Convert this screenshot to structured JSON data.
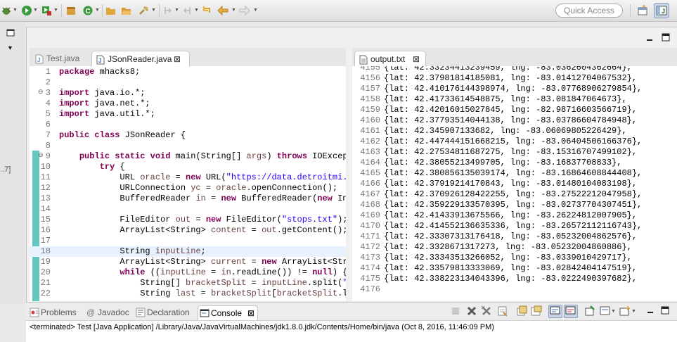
{
  "toolbar": {
    "quick_access_placeholder": "Quick Access"
  },
  "left_strip": {
    "marker": "..7]"
  },
  "editor_tabs": [
    {
      "label": "Test.java"
    },
    {
      "label": "JSonReader.java"
    }
  ],
  "output_tab": {
    "label": "output.txt"
  },
  "code_lines": [
    {
      "n": "1",
      "text": "package mhacks8;"
    },
    {
      "n": "2",
      "text": ""
    },
    {
      "n": "3",
      "text": "import java.io.*;"
    },
    {
      "n": "4",
      "text": "import java.net.*;"
    },
    {
      "n": "5",
      "text": "import java.util.*;"
    },
    {
      "n": "6",
      "text": ""
    },
    {
      "n": "7",
      "text": "public class JSonReader {"
    },
    {
      "n": "8",
      "text": ""
    },
    {
      "n": "9",
      "text": "    public static void main(String[] args) throws IOExcep"
    },
    {
      "n": "10",
      "text": "        try {"
    },
    {
      "n": "11",
      "text": "            URL oracle = new URL(\"https://data.detroitmi."
    },
    {
      "n": "12",
      "text": "            URLConnection yc = oracle.openConnection();"
    },
    {
      "n": "13",
      "text": "            BufferedReader in = new BufferedReader(new In"
    },
    {
      "n": "14",
      "text": ""
    },
    {
      "n": "15",
      "text": "            FileEditor out = new FileEditor(\"stops.txt\");"
    },
    {
      "n": "16",
      "text": "            ArrayList<String> content = out.getContent();"
    },
    {
      "n": "17",
      "text": ""
    },
    {
      "n": "18",
      "text": "            String inputLine;"
    },
    {
      "n": "19",
      "text": "            ArrayList<String> current = new ArrayList<Str"
    },
    {
      "n": "20",
      "text": "            while ((inputLine = in.readLine()) != null) {"
    },
    {
      "n": "21",
      "text": "                String[] bracketSplit = inputLine.split(\""
    },
    {
      "n": "22",
      "text": "                String last = bracketSplit[bracketSplit.l"
    }
  ],
  "output_lines": [
    {
      "n": "4155",
      "text": "{lat: 42.33234413239459, lng: -83.0362604362664},"
    },
    {
      "n": "4156",
      "text": "{lat: 42.37981814185081, lng: -83.01412704067532},"
    },
    {
      "n": "4157",
      "text": "{lat: 42.410176144398974, lng: -83.07768906279854},"
    },
    {
      "n": "4158",
      "text": "{lat: 42.41733614548875, lng: -83.081847064673},"
    },
    {
      "n": "4159",
      "text": "{lat: 42.42016015027845, lng: -82.98716603566719},"
    },
    {
      "n": "4160",
      "text": "{lat: 42.37793514044138, lng: -83.03786604784948},"
    },
    {
      "n": "4161",
      "text": "{lat: 42.345907133682, lng: -83.06069805226429},"
    },
    {
      "n": "4162",
      "text": "{lat: 42.447444151668215, lng: -83.06404506166376},"
    },
    {
      "n": "4163",
      "text": "{lat: 42.27534811687275, lng: -83.15316707499102},"
    },
    {
      "n": "4164",
      "text": "{lat: 42.38055213499705, lng: -83.16837708833},"
    },
    {
      "n": "4165",
      "text": "{lat: 42.380856135039174, lng: -83.16864608844408},"
    },
    {
      "n": "4166",
      "text": "{lat: 42.37919214170843, lng: -83.01480104083198},"
    },
    {
      "n": "4167",
      "text": "{lat: 42.370926128422255, lng: -83.27522212047958},"
    },
    {
      "n": "4168",
      "text": "{lat: 42.359229133570395, lng: -83.02737704307451},"
    },
    {
      "n": "4169",
      "text": "{lat: 42.41433913675566, lng: -83.26224812007905},"
    },
    {
      "n": "4170",
      "text": "{lat: 42.414552136635336, lng: -83.26572112116743},"
    },
    {
      "n": "4171",
      "text": "{lat: 42.33307313176418, lng: -83.05232004862576},"
    },
    {
      "n": "4172",
      "text": "{lat: 42.3328671317273, lng: -83.05232004860886},"
    },
    {
      "n": "4173",
      "text": "{lat: 42.33343513266052, lng: -83.0339010429717},"
    },
    {
      "n": "4174",
      "text": "{lat: 42.33579813333069, lng: -83.02842404147519},"
    },
    {
      "n": "4175",
      "text": "{lat: 42.338223134043396, lng: -83.0222490397682},"
    },
    {
      "n": "4176",
      "text": ""
    }
  ],
  "console_tabs": [
    {
      "label": "Problems"
    },
    {
      "label": "Javadoc"
    },
    {
      "label": "Declaration"
    },
    {
      "label": "Console"
    }
  ],
  "console": {
    "status": "<terminated> Test [Java Application] /Library/Java/JavaVirtualMachines/jdk1.8.0.jdk/Contents/Home/bin/java (Oct 8, 2016, 11:46:09 PM)"
  },
  "colors": {
    "keyword": "#7f0055",
    "string": "#2a00ff",
    "variable": "#6a3e3e",
    "accent": "#3574ba"
  }
}
